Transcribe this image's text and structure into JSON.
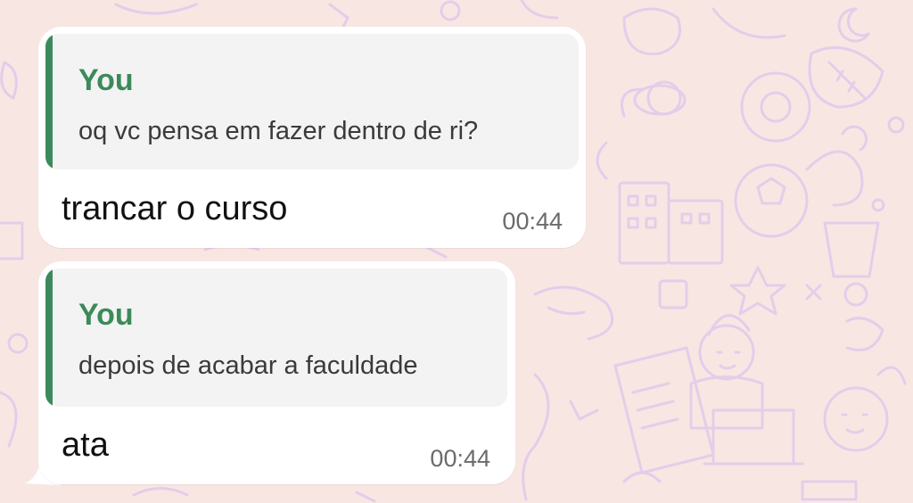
{
  "chat": {
    "messages": [
      {
        "reply_to": {
          "author": "You",
          "text": "oq vc pensa em fazer dentro de ri?"
        },
        "text": "trancar o curso",
        "time": "00:44"
      },
      {
        "reply_to": {
          "author": "You",
          "text": "depois de acabar a faculdade"
        },
        "text": "ata",
        "time": "00:44"
      }
    ]
  },
  "colors": {
    "background": "#f8e6e3",
    "doodle": "#e4cdea",
    "bubble": "#ffffff",
    "quote_background": "#f3f3f3",
    "quote_accent": "#3c8a5b",
    "timestamp": "#6b6b6b"
  }
}
